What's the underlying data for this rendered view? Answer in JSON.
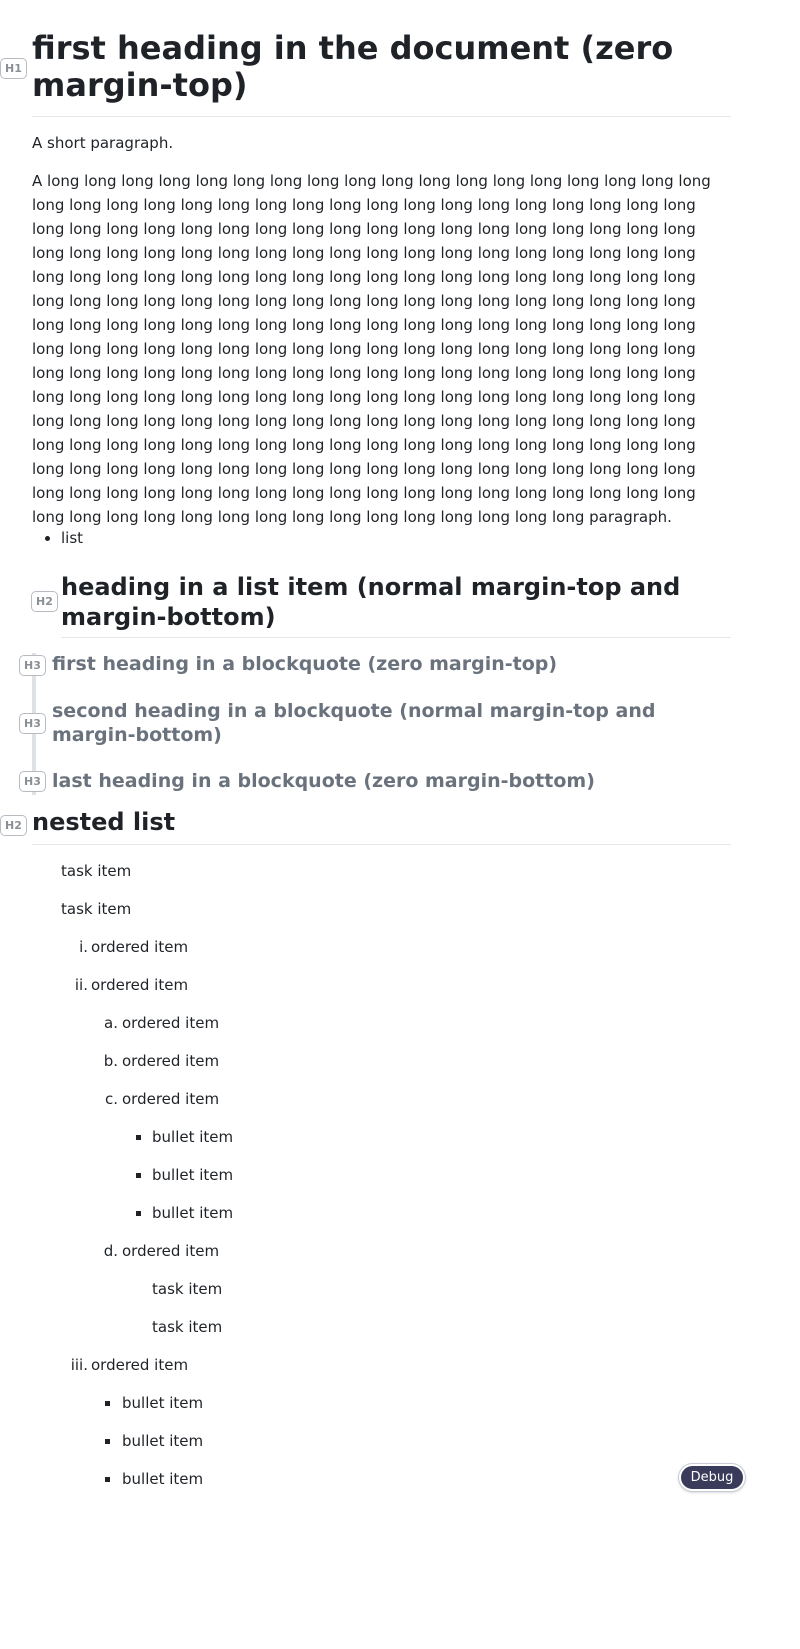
{
  "tags": {
    "h1": "H1",
    "h2": "H2",
    "h3": "H3"
  },
  "heading1": "first heading in the document (zero margin-top)",
  "short_paragraph": "A short paragraph.",
  "long_paragraph": "A long long long long long long long long long long long long long long long long long long long long long long long long long long long long long long long long long long long long long long long long long long long long long long long long long long long long long long long long long long long long long long long long long long long long long long long long long long long long long long long long long long long long long long long long long long long long long long long long long long long long long long long long long long long long long long long long long long long long long long long long long long long long long long long long long long long long long long long long long long long long long long long long long long long long long long long long long long long long long long long long long long long long long long long long long long long long long long long long long long long long long long long long long long long long long long long long long long long long long long long long long long long long long long long long long long long long long long long long long long long long long long long long long long long long long long long long long long long long long long long long long long long long long long long long long long long long long long long long long long long long long long long long long long long paragraph.",
  "list_item": "list",
  "list_heading": "heading in a list item (normal margin-top and margin-bottom)",
  "blockquote": {
    "first": "first heading in a blockquote (zero margin-top)",
    "second": "second heading in a blockquote (normal margin-top and margin-bottom)",
    "last": "last heading in a blockquote (zero margin-bottom)"
  },
  "nested_heading": "nested list",
  "nested": {
    "task_1": "task item",
    "task_2": "task item",
    "ord_i_marker": "i.",
    "ord_i": "ordered item",
    "ord_ii_marker": "ii.",
    "ord_ii": "ordered item",
    "ord_a_marker": "a.",
    "ord_a": "ordered item",
    "ord_b_marker": "b.",
    "ord_b": "ordered item",
    "ord_c_marker": "c.",
    "ord_c": "ordered item",
    "bullet_c1": "bullet item",
    "bullet_c2": "bullet item",
    "bullet_c3": "bullet item",
    "ord_d_marker": "d.",
    "ord_d": "ordered item",
    "task_d1": "task item",
    "task_d2": "task item",
    "ord_iii_marker": "iii.",
    "ord_iii": "ordered item",
    "bullet_iii1": "bullet item",
    "bullet_iii2": "bullet item",
    "bullet_iii3": "bullet item"
  },
  "debug_button": "Debug"
}
